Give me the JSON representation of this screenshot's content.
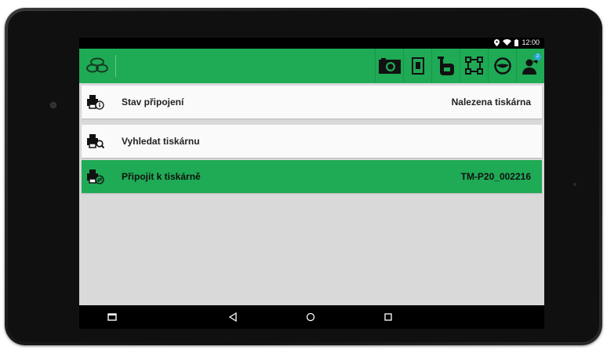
{
  "status_bar": {
    "time": "12:00",
    "icons": [
      "location-icon",
      "wifi-icon",
      "battery-icon"
    ]
  },
  "app_bar": {
    "logo": "app-logo",
    "tools": [
      {
        "name": "camera-icon"
      },
      {
        "name": "document-icon"
      },
      {
        "name": "tachograph-icon"
      },
      {
        "name": "grid-icon"
      },
      {
        "name": "steering-wheel-icon"
      },
      {
        "name": "user-messages-icon",
        "badge": "2"
      }
    ]
  },
  "rows": [
    {
      "label": "Stav připojení",
      "value": "Nalezena tiskárna",
      "icon": "printer-info-icon",
      "active": false
    },
    {
      "label": "Vyhledat tiskárnu",
      "value": "",
      "icon": "printer-search-icon",
      "active": false
    },
    {
      "label": "Připojit k tiskárně",
      "value": "TM-P20_002216",
      "icon": "printer-connect-icon",
      "active": true
    }
  ],
  "nav_bar": {
    "buttons": [
      "recent-apps-icon",
      "back-icon",
      "home-icon",
      "overview-icon"
    ]
  },
  "colors": {
    "accent": "#1faa55",
    "background": "#d9d9d9",
    "row": "#fafafa"
  }
}
